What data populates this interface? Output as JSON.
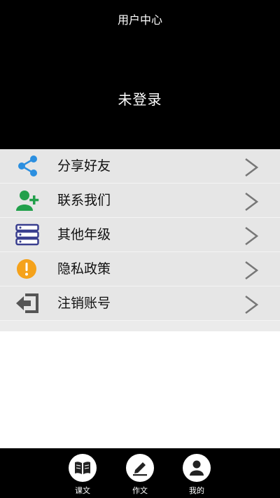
{
  "header": {
    "title": "用户中心",
    "login_status": "未登录"
  },
  "menu": {
    "items": [
      {
        "label": "分享好友",
        "icon": "share-icon",
        "color": "#2b8fe0"
      },
      {
        "label": "联系我们",
        "icon": "add-contact-icon",
        "color": "#22a04b"
      },
      {
        "label": "其他年级",
        "icon": "server-stack-icon",
        "color": "#3a3f8f"
      },
      {
        "label": "隐私政策",
        "icon": "warning-circle-icon",
        "color": "#f5a21b"
      },
      {
        "label": "注销账号",
        "icon": "logout-icon",
        "color": "#555555"
      }
    ]
  },
  "tabbar": {
    "tabs": [
      {
        "label": "课文",
        "icon": "book-icon"
      },
      {
        "label": "作文",
        "icon": "pencil-icon"
      },
      {
        "label": "我的",
        "icon": "user-icon"
      }
    ]
  }
}
